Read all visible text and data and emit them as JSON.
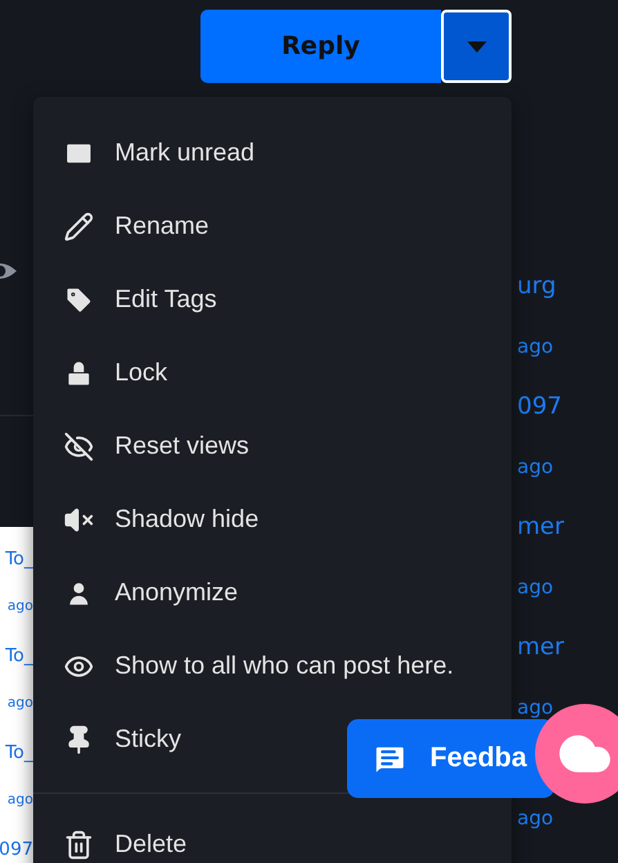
{
  "reply_button": {
    "label": "Reply"
  },
  "dropdown_toggle": {
    "expanded": true
  },
  "menu": {
    "items": [
      {
        "label": "Mark unread"
      },
      {
        "label": "Rename"
      },
      {
        "label": "Edit Tags"
      },
      {
        "label": "Lock"
      },
      {
        "label": "Reset views"
      },
      {
        "label": "Shadow hide"
      },
      {
        "label": "Anonymize"
      },
      {
        "label": "Show to all who can post here."
      },
      {
        "label": "Sticky"
      }
    ],
    "footer_items": [
      {
        "label": "Delete"
      }
    ]
  },
  "right_column": [
    {
      "title": "urg",
      "time": "ago"
    },
    {
      "title": "097",
      "time": "ago"
    },
    {
      "title": "mer",
      "time": "ago"
    },
    {
      "title": "mer",
      "time": "ago"
    },
    {
      "time": "ago"
    }
  ],
  "left_panel": [
    {
      "title": "To_",
      "time": "ago"
    },
    {
      "title": "To_",
      "time": "ago"
    },
    {
      "title": "To_",
      "time": "ago"
    },
    {
      "title": "097"
    }
  ],
  "feedback_button": {
    "label": "Feedba"
  }
}
